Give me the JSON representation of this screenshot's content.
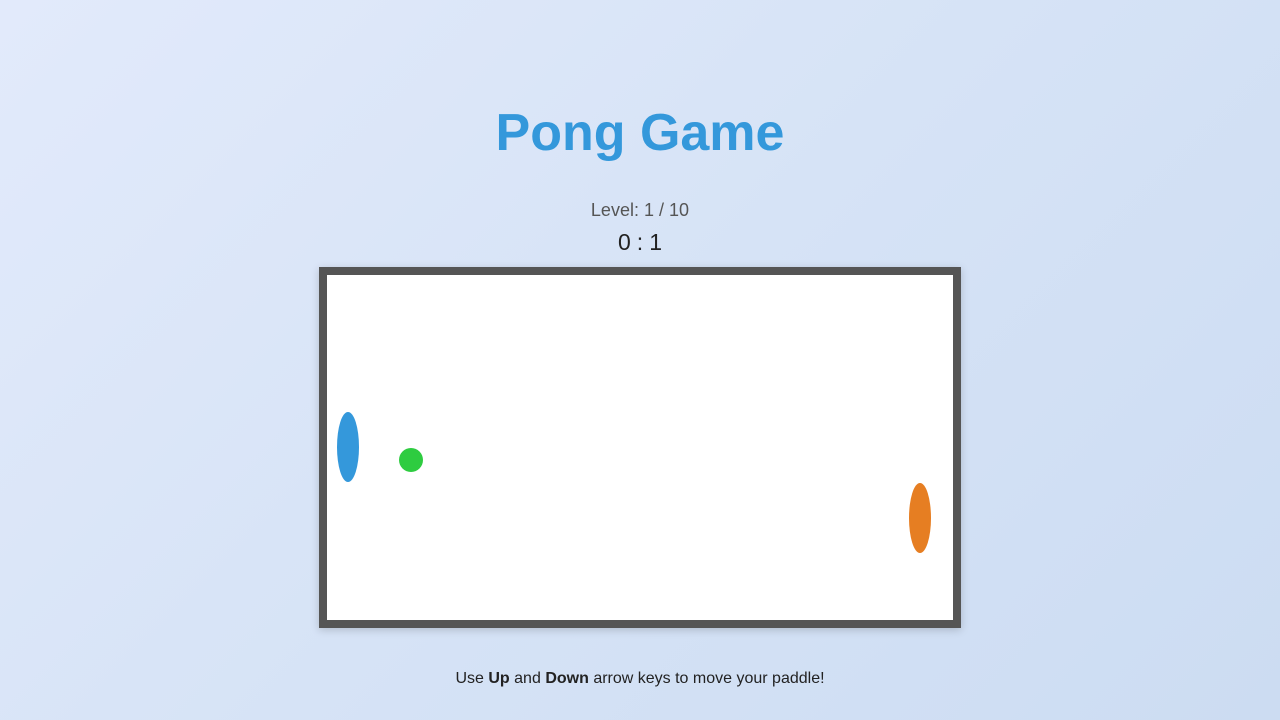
{
  "game": {
    "title": "Pong Game",
    "level_label": "Level:",
    "level_current": "1",
    "level_separator": "/",
    "level_total": "10",
    "score_left": "0",
    "score_separator": ":",
    "score_right": "1"
  },
  "board": {
    "background": "#ffffff",
    "border_color": "#555555",
    "player_paddle_color": "#3498db",
    "cpu_paddle_color": "#e67e22",
    "ball_color": "#2ecc40"
  },
  "instructions": {
    "prefix": "Use",
    "key_up": "Up",
    "middle": "and",
    "key_down": "Down",
    "suffix": "arrow keys to move your paddle!"
  }
}
